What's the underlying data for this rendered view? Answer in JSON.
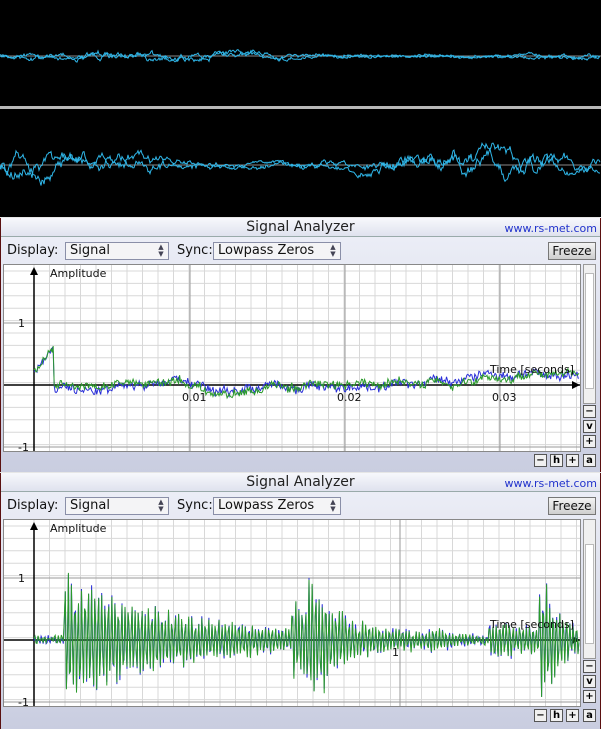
{
  "analyzer_top": {
    "title": "Signal Analyzer",
    "link": "www.rs-met.com",
    "display_label": "Display:",
    "display_value": "Signal",
    "sync_label": "Sync:",
    "sync_value": "Lowpass Zeros",
    "freeze_label": "Freeze",
    "y_axis_label": "Amplitude",
    "x_axis_label": "Time [seconds]",
    "y_ticks": [
      "1",
      "-1"
    ],
    "x_ticks": [
      "0.01",
      "0.02",
      "0.03"
    ],
    "zoom_buttons": [
      "−",
      "h",
      "+",
      "a"
    ],
    "vzoom_buttons": [
      "−",
      "v",
      "+"
    ]
  },
  "analyzer_bottom": {
    "title": "Signal Analyzer",
    "link": "www.rs-met.com",
    "display_label": "Display:",
    "display_value": "Signal",
    "sync_label": "Sync:",
    "sync_value": "Lowpass Zeros",
    "freeze_label": "Freeze",
    "y_axis_label": "Amplitude",
    "x_axis_label": "Time [seconds]",
    "y_ticks": [
      "1",
      "-1"
    ],
    "x_ticks": [
      "1"
    ],
    "zoom_buttons": [
      "−",
      "h",
      "+",
      "a"
    ],
    "vzoom_buttons": [
      "−",
      "v",
      "+"
    ]
  },
  "colors": {
    "waveform_cyan": "#2fb6e8",
    "channel_blue": "#2a2fd8",
    "channel_green": "#2a9a2a",
    "grid_major": "#9a9a9a",
    "grid_minor": "#d8d8d8"
  }
}
